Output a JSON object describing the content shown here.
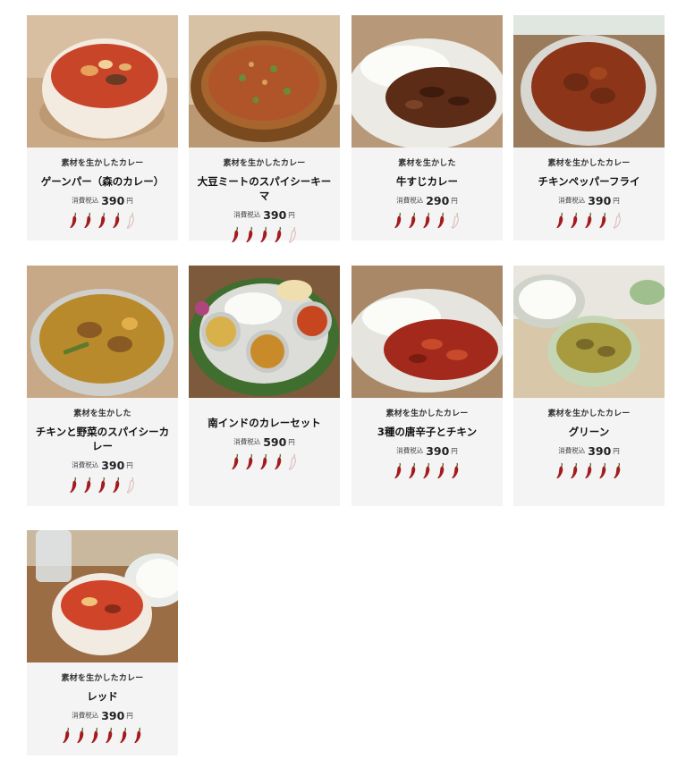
{
  "colors": {
    "card_bg": "#f4f4f4",
    "pepper_filled": "#a31b1e",
    "pepper_empty": "#d9b8b3"
  },
  "products": [
    {
      "subtitle": "素材を生かしたカレー",
      "name": "ゲーンパー（森のカレー）",
      "tax_label": "消費税込",
      "price": "390",
      "currency": "円",
      "spice_level": 4,
      "spice_max": 5,
      "image": "curry-bowl-red-vegetables"
    },
    {
      "subtitle": "素材を生かしたカレー",
      "name": "大豆ミートのスパイシーキーマ",
      "tax_label": "消費税込",
      "price": "390",
      "currency": "円",
      "spice_level": 4,
      "spice_max": 5,
      "image": "keema-curry-plate"
    },
    {
      "subtitle": "素材を生かした",
      "name": "牛すじカレー",
      "tax_label": "消費税込",
      "price": "290",
      "currency": "円",
      "spice_level": 4,
      "spice_max": 5,
      "image": "beef-tendon-curry-rice"
    },
    {
      "subtitle": "素材を生かしたカレー",
      "name": "チキンペッパーフライ",
      "tax_label": "消費税込",
      "price": "390",
      "currency": "円",
      "spice_level": 4,
      "spice_max": 5,
      "image": "chicken-pepper-fry-bowl"
    },
    {
      "subtitle": "素材を生かした",
      "name": "チキンと野菜のスパイシーカレー",
      "tax_label": "消費税込",
      "price": "390",
      "currency": "円",
      "spice_level": 4,
      "spice_max": 5,
      "image": "chicken-vegetable-curry-bowl"
    },
    {
      "subtitle": "",
      "name": "南インドのカレーセット",
      "tax_label": "消費税込",
      "price": "590",
      "currency": "円",
      "spice_level": 4,
      "spice_max": 5,
      "image": "south-indian-thali-plate"
    },
    {
      "subtitle": "素材を生かしたカレー",
      "name": "3種の唐辛子とチキン",
      "tax_label": "消費税込",
      "price": "390",
      "currency": "円",
      "spice_level": 5,
      "spice_max": 5,
      "image": "three-chili-chicken-curry-rice"
    },
    {
      "subtitle": "素材を生かしたカレー",
      "name": "グリーン",
      "tax_label": "消費税込",
      "price": "390",
      "currency": "円",
      "spice_level": 5,
      "spice_max": 5,
      "image": "green-curry-bowl"
    },
    {
      "subtitle": "素材を生かしたカレー",
      "name": "レッド",
      "tax_label": "消費税込",
      "price": "390",
      "currency": "円",
      "spice_level": 6,
      "spice_max": 6,
      "image": "red-curry-bowl"
    }
  ]
}
